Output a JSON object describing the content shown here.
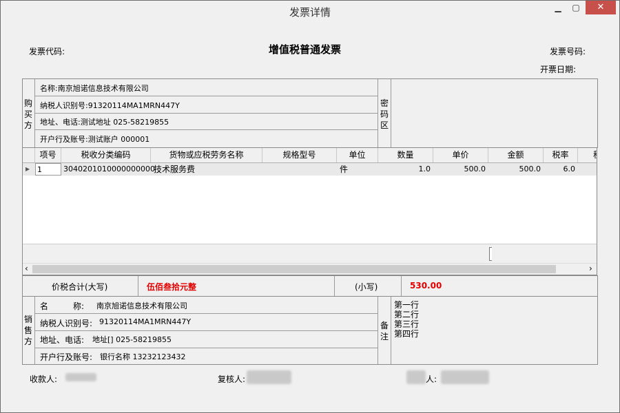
{
  "window": {
    "title": "发票详情"
  },
  "header": {
    "invoice_code_label": "发票代码:",
    "invoice_title": "增值税普通发票",
    "invoice_number_label": "发票号码:",
    "invoice_date_label": "开票日期:"
  },
  "buyer": {
    "side_label": "购买方",
    "name": "名称:南京旭诺信息技术有限公司",
    "tax_id": "纳税人识别号:91320114MA1MRN447Y",
    "address_phone": "地址、电话:测试地址 025-58219855",
    "bank_account": "开户行及账号:测试账户 000001"
  },
  "password_area": {
    "label": "密码区"
  },
  "table": {
    "columns": [
      "项号",
      "税收分类编码",
      "货物或应税劳务名称",
      "规格型号",
      "单位",
      "数量",
      "单价",
      "金额",
      "税率",
      "税"
    ],
    "rows": [
      {
        "index": "1",
        "tax_code": "3040201010000000000",
        "item_name": "技术服务费",
        "spec": "",
        "unit": "件",
        "quantity": "1.0",
        "unit_price": "500.0",
        "amount": "500.0",
        "tax_rate": "6.0"
      }
    ]
  },
  "totals": {
    "total_label": "价税合计(大写)",
    "total_upper": "伍佰叁拾元整",
    "small_label": "(小写)",
    "total_lower": "530.00"
  },
  "seller": {
    "side_label": "销售方",
    "name_label": "名　　　称:",
    "name_value": "南京旭诺信息技术有限公司",
    "tax_id_label": "纳税人识别号:",
    "tax_id_value": "91320114MA1MRN447Y",
    "address_label": "地址、电话:",
    "address_value": "地址[] 025-58219855",
    "bank_label": "开户行及账号:",
    "bank_value": "银行名称 13232123432"
  },
  "remarks": {
    "label": "备注",
    "lines": [
      "第一行",
      "第二行",
      "第三行",
      "第四行"
    ]
  },
  "footer": {
    "payee_label": "收款人:",
    "reviewer_label": "复核人:",
    "issuer_label": "人:"
  },
  "colors": {
    "accent_red": "#e00000",
    "close_button": "#c7504a"
  }
}
